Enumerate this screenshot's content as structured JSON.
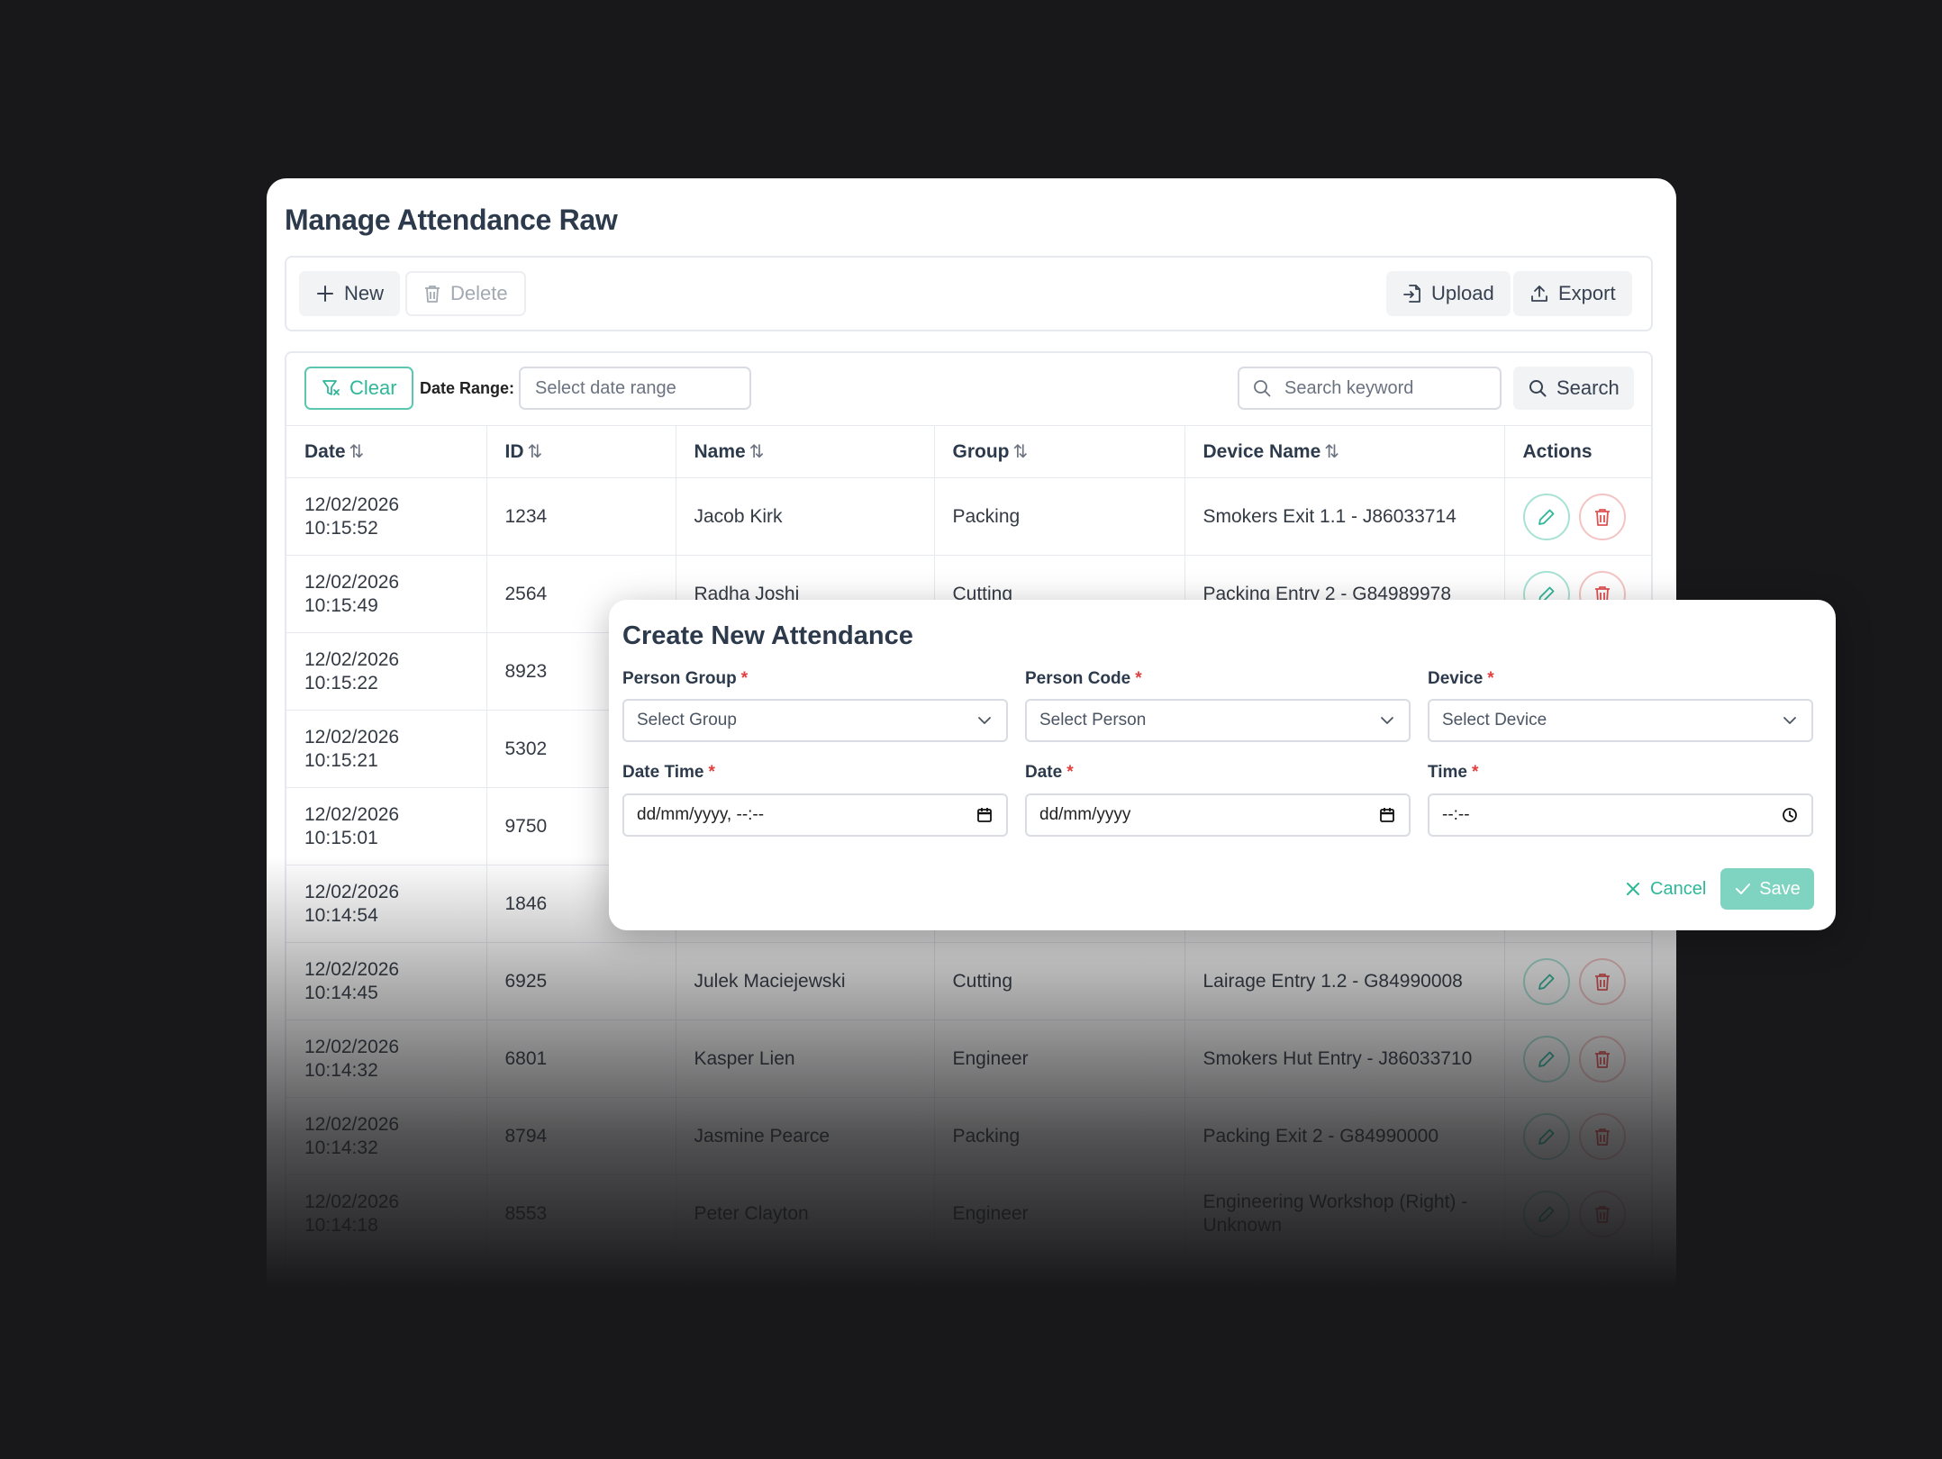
{
  "page": {
    "title": "Manage Attendance Raw"
  },
  "toolbar": {
    "new_label": "New",
    "delete_label": "Delete",
    "upload_label": "Upload",
    "export_label": "Export"
  },
  "filters": {
    "clear_label": "Clear",
    "date_range_label": "Date Range:",
    "date_range_placeholder": "Select date range",
    "search_placeholder": "Search keyword",
    "search_label": "Search"
  },
  "table": {
    "columns": [
      "Date",
      "ID",
      "Name",
      "Group",
      "Device Name",
      "Actions"
    ],
    "sort_glyph": "⇅",
    "rows": [
      {
        "date": "12/02/2026 10:15:52",
        "id": "1234",
        "name": "Jacob Kirk",
        "group": "Packing",
        "device": "Smokers Exit 1.1 - J86033714"
      },
      {
        "date": "12/02/2026 10:15:49",
        "id": "2564",
        "name": "Radha Joshi",
        "group": "Cutting",
        "device": "Packing Entry 2 - G84989978"
      },
      {
        "date": "12/02/2026 10:15:22",
        "id": "8923",
        "name": "",
        "group": "",
        "device": ""
      },
      {
        "date": "12/02/2026 10:15:21",
        "id": "5302",
        "name": "",
        "group": "",
        "device": ""
      },
      {
        "date": "12/02/2026 10:15:01",
        "id": "9750",
        "name": "",
        "group": "",
        "device": ""
      },
      {
        "date": "12/02/2026 10:14:54",
        "id": "1846",
        "name": "",
        "group": "",
        "device": ""
      },
      {
        "date": "12/02/2026 10:14:45",
        "id": "6925",
        "name": "Julek Maciejewski",
        "group": "Cutting",
        "device": "Lairage Entry 1.2 - G84990008"
      },
      {
        "date": "12/02/2026 10:14:32",
        "id": "6801",
        "name": "Kasper Lien",
        "group": "Engineer",
        "device": "Smokers Hut Entry - J86033710"
      },
      {
        "date": "12/02/2026 10:14:32",
        "id": "8794",
        "name": "Jasmine Pearce",
        "group": "Packing",
        "device": "Packing Exit 2 - G84990000"
      },
      {
        "date": "12/02/2026 10:14:18",
        "id": "8553",
        "name": "Peter Clayton",
        "group": "Engineer",
        "device": "Engineering Workshop (Right) - Unknown"
      }
    ]
  },
  "modal": {
    "title": "Create New Attendance",
    "person_group_label": "Person Group",
    "person_group_value": "Select Group",
    "person_code_label": "Person Code",
    "person_code_value": "Select Person",
    "device_label": "Device",
    "device_value": "Select Device",
    "datetime_label": "Date Time",
    "datetime_value": "dd/mm/yyyy, --:--",
    "date_label": "Date",
    "date_value": "dd/mm/yyyy",
    "time_label": "Time",
    "time_value": "--:--",
    "required_mark": "*",
    "cancel_label": "Cancel",
    "save_label": "Save"
  },
  "colors": {
    "accent": "#2fb79a",
    "danger": "#e05252",
    "background": "#18181a"
  }
}
